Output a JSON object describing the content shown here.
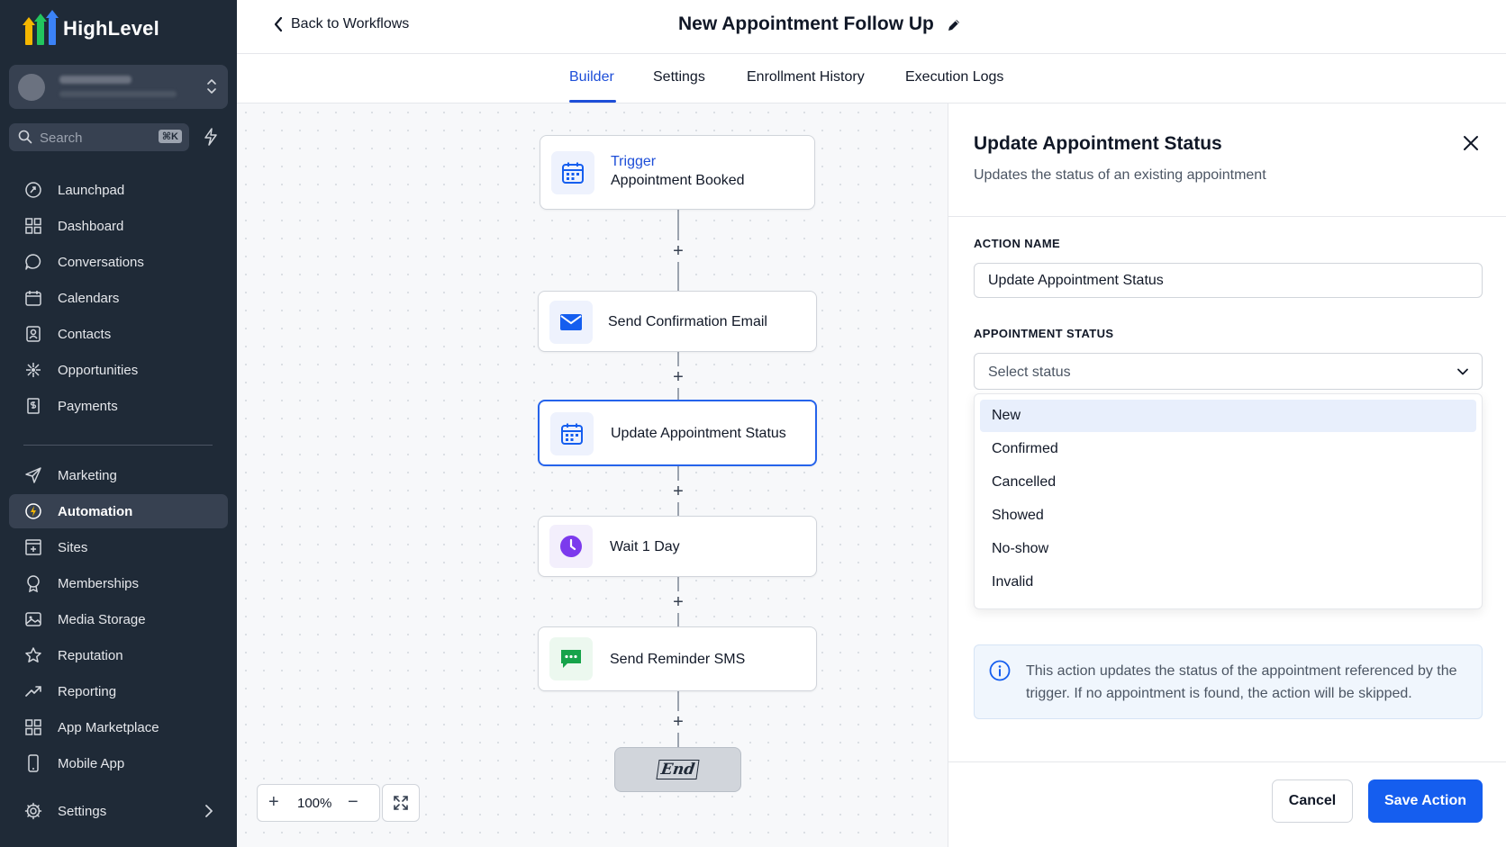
{
  "brand": {
    "name": "HighLevel",
    "accent": "#155eef"
  },
  "sidebar": {
    "search_label": "Search",
    "search_shortcut": "⌘K",
    "items": [
      {
        "label": "Launchpad",
        "icon": "launchpad-icon"
      },
      {
        "label": "Dashboard",
        "icon": "dashboard-icon"
      },
      {
        "label": "Conversations",
        "icon": "chat-icon"
      },
      {
        "label": "Calendars",
        "icon": "calendar-icon"
      },
      {
        "label": "Contacts",
        "icon": "contacts-icon"
      },
      {
        "label": "Opportunities",
        "icon": "opportunities-icon"
      },
      {
        "label": "Payments",
        "icon": "payments-icon"
      },
      {
        "label": "Marketing",
        "icon": "send-icon"
      },
      {
        "label": "Automation",
        "icon": "automation-icon",
        "active": true
      },
      {
        "label": "Sites",
        "icon": "sites-icon"
      },
      {
        "label": "Memberships",
        "icon": "membership-icon"
      },
      {
        "label": "Media Storage",
        "icon": "image-icon"
      },
      {
        "label": "Reputation",
        "icon": "star-icon"
      },
      {
        "label": "Reporting",
        "icon": "trend-icon"
      },
      {
        "label": "App Marketplace",
        "icon": "grid-icon"
      },
      {
        "label": "Mobile App",
        "icon": "phone-icon"
      },
      {
        "label": "Settings",
        "icon": "gear-icon"
      }
    ]
  },
  "header": {
    "back_label": "Back to Workflows",
    "title": "New Appointment Follow Up"
  },
  "tabs": [
    {
      "label": "Builder",
      "active": true
    },
    {
      "label": "Settings"
    },
    {
      "label": "Enrollment History"
    },
    {
      "label": "Execution Logs"
    }
  ],
  "workflow": {
    "trigger": {
      "kind": "Trigger",
      "label": "Appointment Booked"
    },
    "steps": [
      {
        "label": "Send Confirmation Email",
        "icon": "mail-icon"
      },
      {
        "label": "Update Appointment Status",
        "icon": "calendar-icon",
        "selected": true
      },
      {
        "label": "Wait 1 Day",
        "icon": "clock-icon"
      },
      {
        "label": "Send Reminder SMS",
        "icon": "sms-icon"
      }
    ],
    "end_label": "End",
    "zoom": "100%"
  },
  "panel": {
    "title": "Update Appointment Status",
    "subtitle": "Updates the status of an existing appointment",
    "action_name_label": "ACTION NAME",
    "action_name_value": "Update Appointment Status",
    "status_label": "APPOINTMENT STATUS",
    "status_placeholder": "Select status",
    "status_options": [
      "New",
      "Confirmed",
      "Cancelled",
      "Showed",
      "No-show",
      "Invalid"
    ],
    "info_text": "This action updates the status of the appointment referenced by the trigger. If no appointment is found, the action will be skipped.",
    "cancel_label": "Cancel",
    "save_label": "Save Action"
  }
}
